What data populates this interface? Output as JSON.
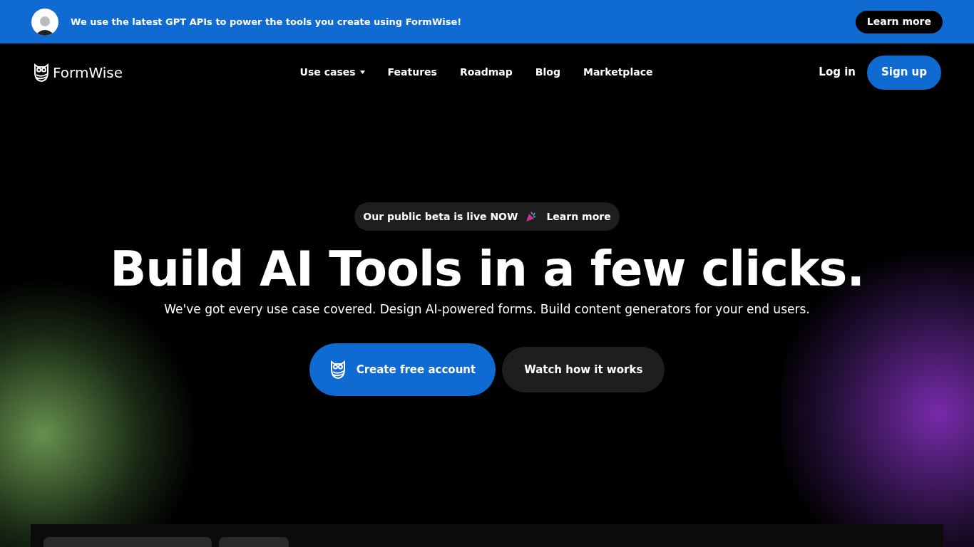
{
  "banner": {
    "text": "We use the latest GPT APIs to power the tools you create using FormWise!",
    "button": "Learn more"
  },
  "nav": {
    "logo": "FormWise",
    "links": [
      {
        "label": "Use cases",
        "dropdown": true
      },
      {
        "label": "Features",
        "dropdown": false
      },
      {
        "label": "Roadmap",
        "dropdown": false
      },
      {
        "label": "Blog",
        "dropdown": false
      },
      {
        "label": "Marketplace",
        "dropdown": false
      }
    ],
    "login": "Log in",
    "signup": "Sign up"
  },
  "hero": {
    "pill_text": "Our public beta is live NOW",
    "pill_link": "Learn more",
    "title": "Build AI Tools in a few clicks.",
    "subtitle": "We've got every use case covered. Design AI-powered forms. Build content generators for your end users.",
    "primary": "Create free account",
    "secondary": "Watch how it works"
  }
}
